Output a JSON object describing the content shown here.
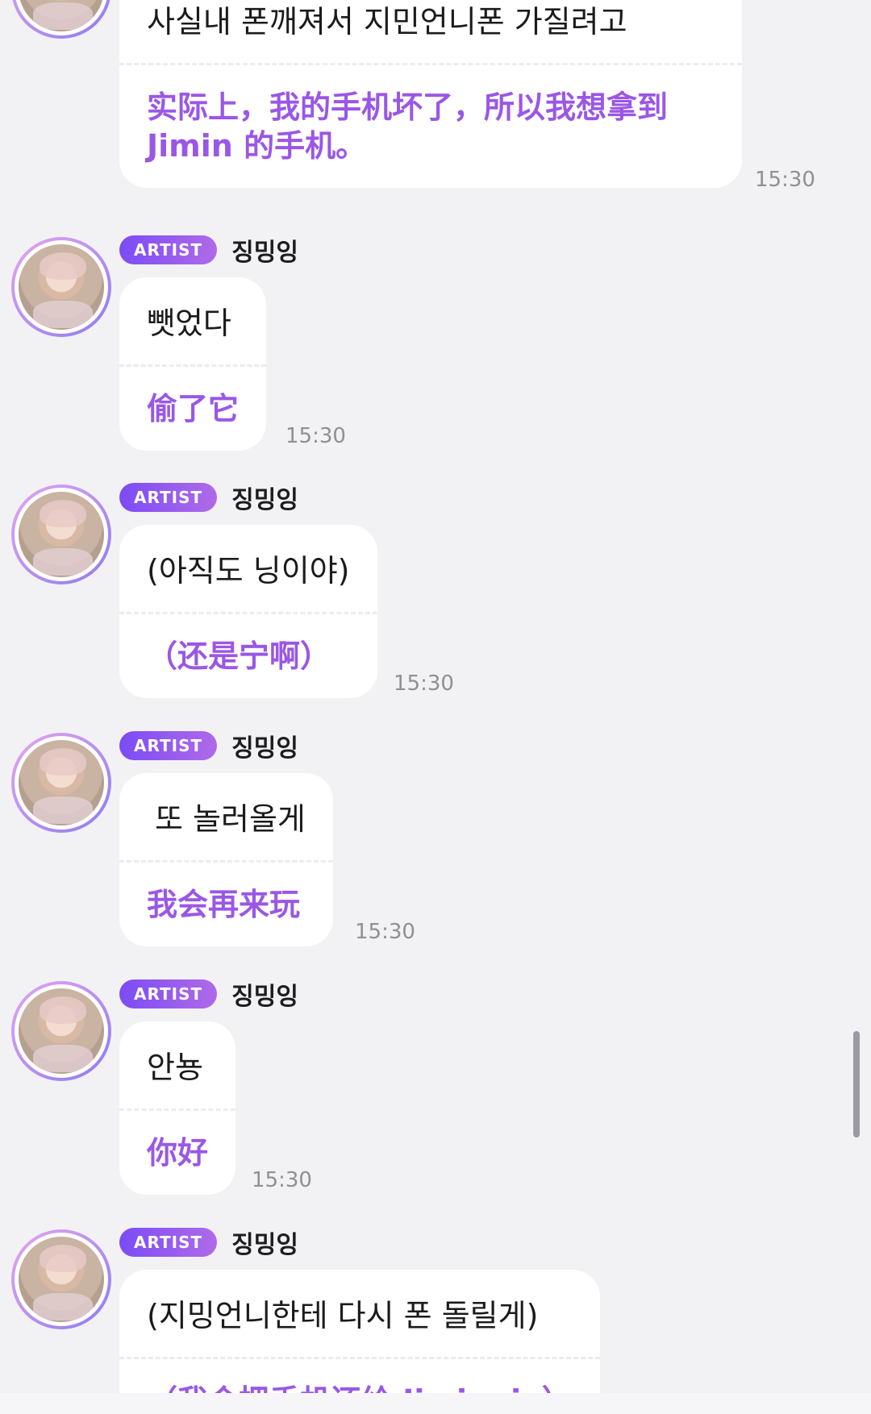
{
  "messages": [
    {
      "korean": "사실내 폰깨져서 지민언니폰 가질려고",
      "translation": "实际上，我的手机坏了，所以我想拿到 Jimin 的手机。",
      "time": "15:30"
    },
    {
      "badge": "ARTIST",
      "name": "징밍잉",
      "korean": "뺏었다",
      "translation": "偷了它",
      "time": "15:30"
    },
    {
      "badge": "ARTIST",
      "name": "징밍잉",
      "korean": "(아직도 닝이야)",
      "translation": "（还是宁啊）",
      "time": "15:30"
    },
    {
      "badge": "ARTIST",
      "name": "징밍잉",
      "korean": "또 놀러올게",
      "translation": "我会再来玩",
      "time": "15:30"
    },
    {
      "badge": "ARTIST",
      "name": "징밍잉",
      "korean": "안뇽",
      "translation": "你好",
      "time": "15:30"
    },
    {
      "badge": "ARTIST",
      "name": "징밍잉",
      "korean": "(지밍언니한테 다시 폰 돌릴게)",
      "translation": "（我会把手机还给 Jiminnie）"
    }
  ],
  "colors": {
    "badge": "#7b4cf5",
    "translation_text": "#9a57e6",
    "background": "#f2f2f4"
  },
  "icons": {
    "avatar": "baby-photo-avatar"
  }
}
